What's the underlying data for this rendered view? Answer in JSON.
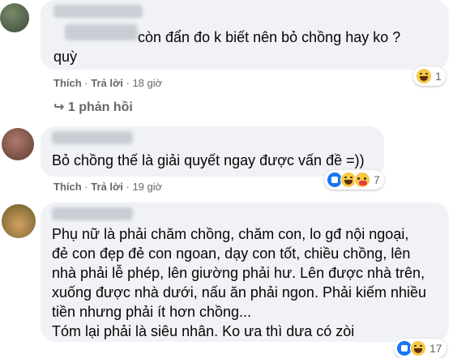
{
  "comments": [
    {
      "lines": [
        "còn đẩn đo k biết nên bỏ chồng hay ko ?",
        "quỳ"
      ],
      "like_label": "Thích",
      "reply_label": "Trả lời",
      "time": "18 giờ",
      "reaction_count": "1",
      "replies_label": "1 phản hồi"
    },
    {
      "lines": [
        "Bỏ chồng thế là giải quyết ngay được vấn đề =))"
      ],
      "like_label": "Thích",
      "reply_label": "Trả lời",
      "time": "19 giờ",
      "reaction_count": "7"
    },
    {
      "lines": [
        "Phụ nữ là phải chăm chồng, chăm con, lo gđ nội ngoại,",
        "đẻ con đẹp đẻ con ngoan, dạy con tốt, chiều chồng, lên",
        "nhà phải lễ phép, lên giường phải hư. Lên được nhà trên,",
        "xuống được nhà dưới, nấu ăn phải ngon. Phải kiếm nhiều",
        "tiền nhưng phải ít hơn chồng...",
        "Tóm lại phải là siêu nhân. Ko ưa thì dưa có zòi"
      ],
      "reaction_count": "17"
    }
  ],
  "separator": "·",
  "reply_arrow": "↪",
  "colors": {
    "bubble": "#f0f2f5",
    "secondary_text": "#65676b"
  }
}
